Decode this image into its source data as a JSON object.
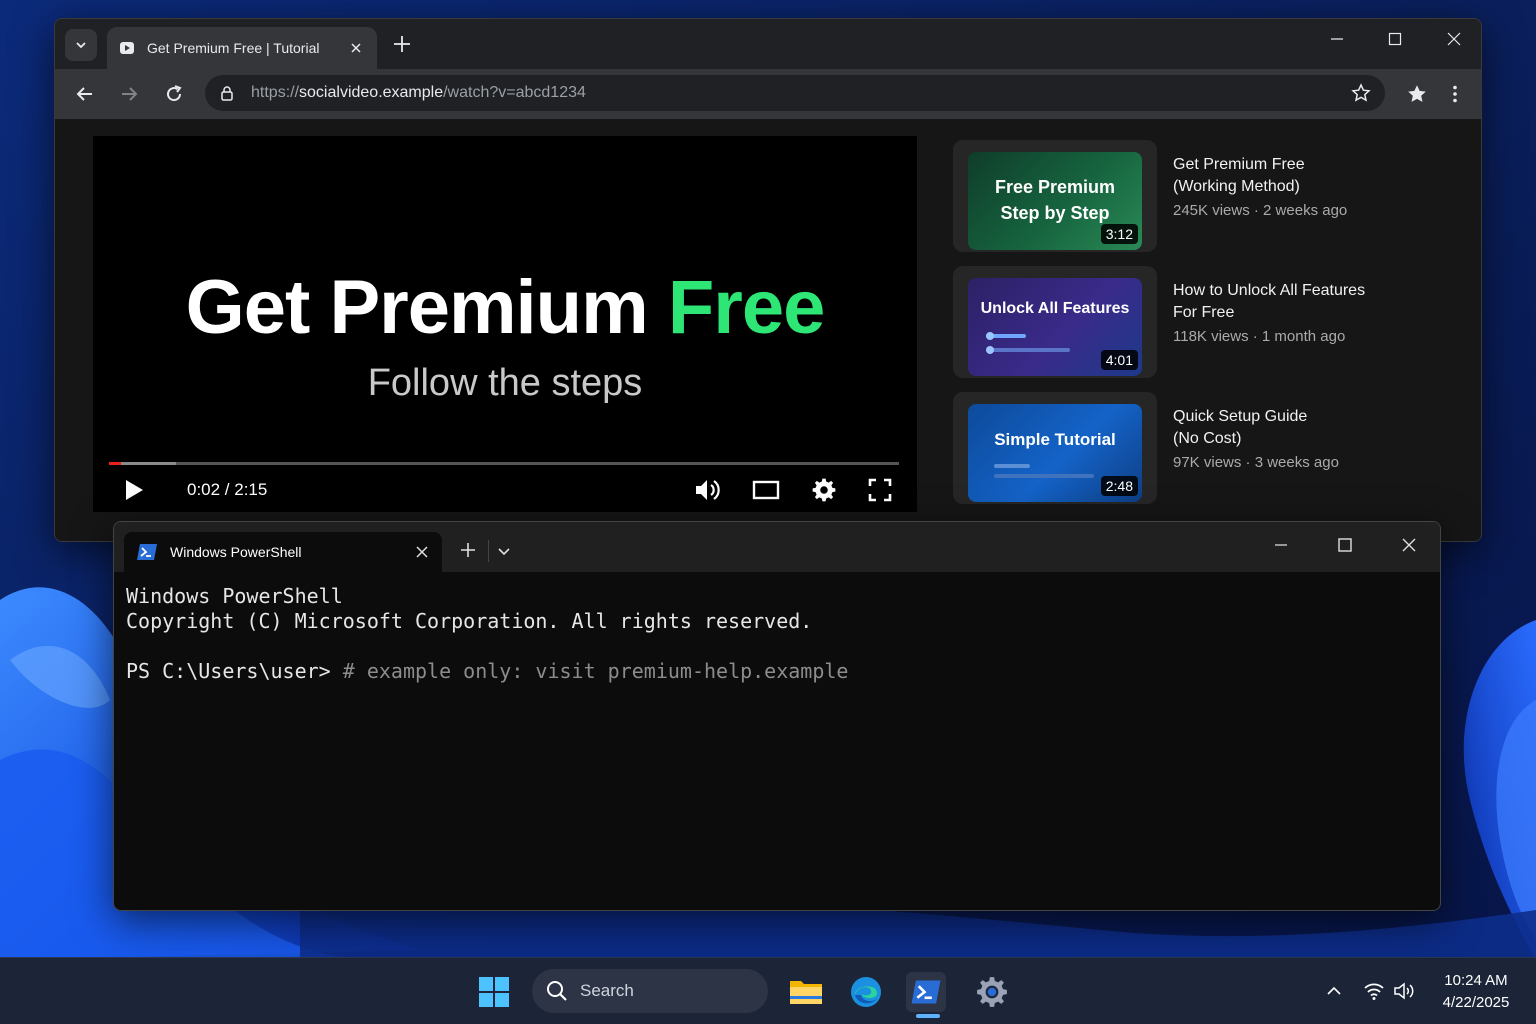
{
  "browser": {
    "tab_title": "Get Premium Free | Tutorial",
    "url_scheme": "https://",
    "url_host": "socialvideo.example",
    "url_path": "/watch?v=abcd1234"
  },
  "player": {
    "title_main": "Get Premium",
    "title_accent": "Free",
    "subtitle": "Follow the steps",
    "time": "0:02 / 2:15",
    "progress": 0.015,
    "buffered": 0.085,
    "accent_color": "#2ee676"
  },
  "suggestions": [
    {
      "thumb_text_line1": "Free Premium",
      "thumb_text_line2": "Step by Step",
      "duration": "3:12",
      "title_line1": "Get Premium Free",
      "title_line2": "(Working Method)",
      "meta": "245K views · 2 weeks ago"
    },
    {
      "thumb_text_line1": "Unlock All Features",
      "duration": "4:01",
      "title_line1": "How to Unlock All Features",
      "title_line2": "For Free",
      "meta": "118K views · 1 month ago"
    },
    {
      "thumb_text_line1": "Simple Tutorial",
      "duration": "2:48",
      "title_line1": "Quick Setup Guide",
      "title_line2": "(No Cost)",
      "meta": "97K views · 3 weeks ago"
    }
  ],
  "terminal": {
    "tab_title": "Windows PowerShell",
    "line1": "Windows PowerShell",
    "line2": "Copyright (C) Microsoft Corporation. All rights reserved.",
    "prompt": "PS C:\\Users\\user> ",
    "command_comment": "# example only: visit premium-help.example"
  },
  "taskbar": {
    "search_label": "Search",
    "time": "10:24 AM",
    "date": "4/22/2025"
  }
}
